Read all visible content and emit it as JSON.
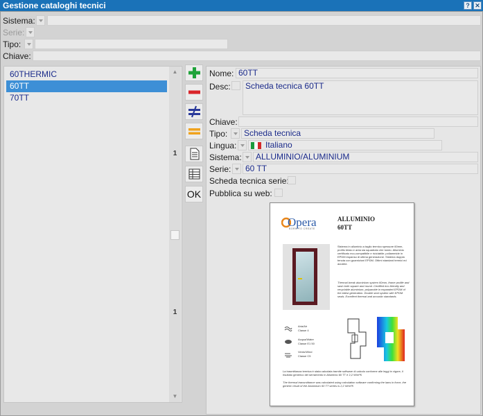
{
  "window": {
    "title": "Gestione cataloghi tecnici",
    "help_label": "?",
    "close_label": "✕"
  },
  "filters": {
    "sistema_label": "Sistema:",
    "serie_label": "Serie:",
    "tipo_label": "Tipo:",
    "chiave_label": "Chiave:"
  },
  "list": {
    "items": [
      "60THERMIC",
      "60TT",
      "70TT"
    ],
    "selected_index": 1,
    "scroll_marks": [
      "1",
      "1"
    ]
  },
  "toolbar": {
    "ok_label": "OK"
  },
  "detail": {
    "nome_label": "Nome:",
    "nome_value": "60TT",
    "desc_label": "Desc:",
    "desc_value": "Scheda tecnica 60TT",
    "chiave_label": "Chiave:",
    "chiave_value": "",
    "tipo_label": "Tipo:",
    "tipo_value": "Scheda tecnica",
    "lingua_label": "Lingua:",
    "lingua_value": "Italiano",
    "sistema_label": "Sistema:",
    "sistema_value": "ALLUMINIO/ALUMINIUM",
    "serie_label": "Serie:",
    "serie_value": "60 TT",
    "scheda_serie_label": "Scheda tecnica serie:",
    "pubblica_label": "Pubblica su web:"
  },
  "preview": {
    "brand": "Opera",
    "brand_tagline": "BORN TO CREATE",
    "title_line1": "ALLUMINIO",
    "title_line2": "60TT",
    "text_it": "Sistema in alluminio a taglio termico spessore 60mm, profilo telaio e anta sia squadrato che tondo. Alluminio certificato eco-compatibile e riciclabile; poliammide in EPDM espanso di ultima generazione. Sistema doppia tenuta con guarnizioni EPDM. Ottimi standard termici ed acustici.",
    "text_en": "Thermal break aluminium system 60mm, frame profile and sash both square and round. Certified eco-friendly and recyclable aluminium; polyamide in expanded EPDM of the latest generation. Double seal system with EPDM seals. Excellent thermal and acoustic standards.",
    "perf": [
      {
        "name": "Aria/Air",
        "class": "Classe 4"
      },
      {
        "name": "Acqua/Water",
        "class": "Classe E1 50"
      },
      {
        "name": "Vento/Wind",
        "class": "Classe C5"
      }
    ],
    "footer_it": "La trasmittanza termica è stata calcolata tramite software di calcolo conforme alle leggi in vigore, il risultato generico del serramento in Alluminio 60 TT è 2,2 W/m²K",
    "footer_en": "The thermal transmittance was calculated using calculation software confirming the laws in force, the generic result of the Aluminium 60 TT series is 2,2 W/m²K",
    "colors": {
      "brand_blue": "#2b5aa8",
      "brand_orange": "#e8861a",
      "frame": "#5a1a22"
    }
  }
}
